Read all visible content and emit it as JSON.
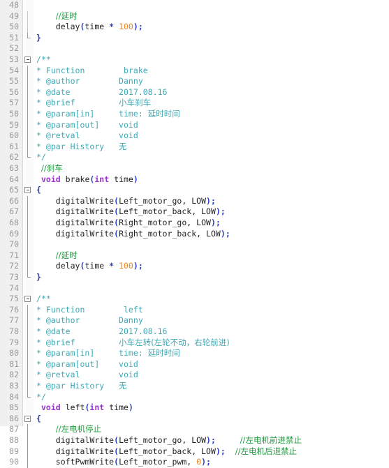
{
  "editor": {
    "kind": "code-editor-pane",
    "language": "c-arduino",
    "first_line": 48,
    "last_line": 90,
    "colors": {
      "background": "#ffffff",
      "gutter_background": "#f0f0f0",
      "gutter_border": "#d9d9d9",
      "line_number": "#9a9a9a",
      "plain_text": "#1f1f1f",
      "line_comment": "#1f9b3f",
      "doc_comment": "#3ea8b4",
      "keyword": "#9b30d0",
      "number": "#e8872a",
      "punctuation": "#2a3fc4",
      "fold_marker": "#8a8a8a"
    },
    "lines": [
      {
        "n": 48,
        "fold": "none",
        "tokens": []
      },
      {
        "n": 49,
        "fold": "bar",
        "tokens": [
          {
            "t": "    ",
            "c": "plain"
          },
          {
            "t": "//延时",
            "c": "comment"
          }
        ]
      },
      {
        "n": 50,
        "fold": "bar",
        "tokens": [
          {
            "t": "    ",
            "c": "plain"
          },
          {
            "t": "delay",
            "c": "func"
          },
          {
            "t": "(",
            "c": "punct"
          },
          {
            "t": "time ",
            "c": "plain"
          },
          {
            "t": "*",
            "c": "punct"
          },
          {
            "t": " ",
            "c": "plain"
          },
          {
            "t": "100",
            "c": "number"
          },
          {
            "t": ");",
            "c": "punct"
          }
        ]
      },
      {
        "n": 51,
        "fold": "end",
        "tokens": [
          {
            "t": "}",
            "c": "punct"
          }
        ]
      },
      {
        "n": 52,
        "fold": "none",
        "tokens": []
      },
      {
        "n": 53,
        "fold": "box",
        "tokens": [
          {
            "t": "/**",
            "c": "doc"
          }
        ]
      },
      {
        "n": 54,
        "fold": "line",
        "tokens": [
          {
            "t": "* Function        brake",
            "c": "doc"
          }
        ]
      },
      {
        "n": 55,
        "fold": "line",
        "tokens": [
          {
            "t": "* @author        Danny",
            "c": "doc"
          }
        ]
      },
      {
        "n": 56,
        "fold": "line",
        "tokens": [
          {
            "t": "* @date          2017.08.16",
            "c": "doc"
          }
        ]
      },
      {
        "n": 57,
        "fold": "line",
        "tokens": [
          {
            "t": "* @brief         ",
            "c": "doc"
          },
          {
            "t": "小车刹车",
            "c": "doc-cn"
          }
        ]
      },
      {
        "n": 58,
        "fold": "line",
        "tokens": [
          {
            "t": "* @param[in]     time: ",
            "c": "doc"
          },
          {
            "t": "延时时间",
            "c": "doc-cn"
          }
        ]
      },
      {
        "n": 59,
        "fold": "line",
        "tokens": [
          {
            "t": "* @param[out]    void",
            "c": "doc"
          }
        ]
      },
      {
        "n": 60,
        "fold": "line",
        "tokens": [
          {
            "t": "* @retval        void",
            "c": "doc"
          }
        ]
      },
      {
        "n": 61,
        "fold": "line",
        "tokens": [
          {
            "t": "* @par History   ",
            "c": "doc"
          },
          {
            "t": "无",
            "c": "doc-cn"
          }
        ]
      },
      {
        "n": 62,
        "fold": "end",
        "tokens": [
          {
            "t": "*/",
            "c": "doc"
          }
        ]
      },
      {
        "n": 63,
        "fold": "none",
        "tokens": [
          {
            "t": " ",
            "c": "plain"
          },
          {
            "t": "//刹车",
            "c": "comment"
          }
        ]
      },
      {
        "n": 64,
        "fold": "none",
        "tokens": [
          {
            "t": " ",
            "c": "plain"
          },
          {
            "t": "void",
            "c": "keyword"
          },
          {
            "t": " brake",
            "c": "func"
          },
          {
            "t": "(",
            "c": "punct"
          },
          {
            "t": "int",
            "c": "keyword"
          },
          {
            "t": " time",
            "c": "plain"
          },
          {
            "t": ")",
            "c": "punct"
          }
        ]
      },
      {
        "n": 65,
        "fold": "box",
        "tokens": [
          {
            "t": "{",
            "c": "punct"
          }
        ]
      },
      {
        "n": 66,
        "fold": "line",
        "tokens": [
          {
            "t": "    ",
            "c": "plain"
          },
          {
            "t": "digitalWrite",
            "c": "func"
          },
          {
            "t": "(",
            "c": "punct"
          },
          {
            "t": "Left_motor_go, LOW",
            "c": "plain"
          },
          {
            "t": ");",
            "c": "punct"
          }
        ]
      },
      {
        "n": 67,
        "fold": "line",
        "tokens": [
          {
            "t": "    ",
            "c": "plain"
          },
          {
            "t": "digitalWrite",
            "c": "func"
          },
          {
            "t": "(",
            "c": "punct"
          },
          {
            "t": "Left_motor_back, LOW",
            "c": "plain"
          },
          {
            "t": ");",
            "c": "punct"
          }
        ]
      },
      {
        "n": 68,
        "fold": "line",
        "tokens": [
          {
            "t": "    ",
            "c": "plain"
          },
          {
            "t": "digitalWrite",
            "c": "func"
          },
          {
            "t": "(",
            "c": "punct"
          },
          {
            "t": "Right_motor_go, LOW",
            "c": "plain"
          },
          {
            "t": ");",
            "c": "punct"
          }
        ]
      },
      {
        "n": 69,
        "fold": "line",
        "tokens": [
          {
            "t": "    ",
            "c": "plain"
          },
          {
            "t": "digitalWrite",
            "c": "func"
          },
          {
            "t": "(",
            "c": "punct"
          },
          {
            "t": "Right_motor_back, LOW",
            "c": "plain"
          },
          {
            "t": ");",
            "c": "punct"
          }
        ]
      },
      {
        "n": 70,
        "fold": "line",
        "tokens": []
      },
      {
        "n": 71,
        "fold": "line",
        "tokens": [
          {
            "t": "    ",
            "c": "plain"
          },
          {
            "t": "//延时",
            "c": "comment"
          }
        ]
      },
      {
        "n": 72,
        "fold": "line",
        "tokens": [
          {
            "t": "    ",
            "c": "plain"
          },
          {
            "t": "delay",
            "c": "func"
          },
          {
            "t": "(",
            "c": "punct"
          },
          {
            "t": "time ",
            "c": "plain"
          },
          {
            "t": "*",
            "c": "punct"
          },
          {
            "t": " ",
            "c": "plain"
          },
          {
            "t": "100",
            "c": "number"
          },
          {
            "t": ");",
            "c": "punct"
          }
        ]
      },
      {
        "n": 73,
        "fold": "end",
        "tokens": [
          {
            "t": "}",
            "c": "punct"
          }
        ]
      },
      {
        "n": 74,
        "fold": "none",
        "tokens": []
      },
      {
        "n": 75,
        "fold": "box",
        "tokens": [
          {
            "t": "/**",
            "c": "doc"
          }
        ]
      },
      {
        "n": 76,
        "fold": "line",
        "tokens": [
          {
            "t": "* Function        left",
            "c": "doc"
          }
        ]
      },
      {
        "n": 77,
        "fold": "line",
        "tokens": [
          {
            "t": "* @author        Danny",
            "c": "doc"
          }
        ]
      },
      {
        "n": 78,
        "fold": "line",
        "tokens": [
          {
            "t": "* @date          2017.08.16",
            "c": "doc"
          }
        ]
      },
      {
        "n": 79,
        "fold": "line",
        "tokens": [
          {
            "t": "* @brief         ",
            "c": "doc"
          },
          {
            "t": "小车左转(左轮不动，右轮前进)",
            "c": "doc-cn"
          }
        ]
      },
      {
        "n": 80,
        "fold": "line",
        "tokens": [
          {
            "t": "* @param[in]     time: ",
            "c": "doc"
          },
          {
            "t": "延时时间",
            "c": "doc-cn"
          }
        ]
      },
      {
        "n": 81,
        "fold": "line",
        "tokens": [
          {
            "t": "* @param[out]    void",
            "c": "doc"
          }
        ]
      },
      {
        "n": 82,
        "fold": "line",
        "tokens": [
          {
            "t": "* @retval        void",
            "c": "doc"
          }
        ]
      },
      {
        "n": 83,
        "fold": "line",
        "tokens": [
          {
            "t": "* @par History   ",
            "c": "doc"
          },
          {
            "t": "无",
            "c": "doc-cn"
          }
        ]
      },
      {
        "n": 84,
        "fold": "end",
        "tokens": [
          {
            "t": "*/",
            "c": "doc"
          }
        ]
      },
      {
        "n": 85,
        "fold": "none",
        "tokens": [
          {
            "t": " ",
            "c": "plain"
          },
          {
            "t": "void",
            "c": "keyword"
          },
          {
            "t": " left",
            "c": "func"
          },
          {
            "t": "(",
            "c": "punct"
          },
          {
            "t": "int",
            "c": "keyword"
          },
          {
            "t": " time",
            "c": "plain"
          },
          {
            "t": ")",
            "c": "punct"
          }
        ]
      },
      {
        "n": 86,
        "fold": "box",
        "tokens": [
          {
            "t": "{",
            "c": "punct"
          }
        ]
      },
      {
        "n": 87,
        "fold": "line",
        "tokens": [
          {
            "t": "    ",
            "c": "plain"
          },
          {
            "t": "//左电机停止",
            "c": "comment"
          }
        ]
      },
      {
        "n": 88,
        "fold": "line",
        "tokens": [
          {
            "t": "    ",
            "c": "plain"
          },
          {
            "t": "digitalWrite",
            "c": "func"
          },
          {
            "t": "(",
            "c": "punct"
          },
          {
            "t": "Left_motor_go, LOW",
            "c": "plain"
          },
          {
            "t": ");",
            "c": "punct"
          },
          {
            "t": "     ",
            "c": "plain"
          },
          {
            "t": "//左电机前进禁止",
            "c": "comment"
          }
        ]
      },
      {
        "n": 89,
        "fold": "line",
        "tokens": [
          {
            "t": "    ",
            "c": "plain"
          },
          {
            "t": "digitalWrite",
            "c": "func"
          },
          {
            "t": "(",
            "c": "punct"
          },
          {
            "t": "Left_motor_back, LOW",
            "c": "plain"
          },
          {
            "t": ");",
            "c": "punct"
          },
          {
            "t": "  ",
            "c": "plain"
          },
          {
            "t": "//左电机后退禁止",
            "c": "comment"
          }
        ]
      },
      {
        "n": 90,
        "fold": "line",
        "tokens": [
          {
            "t": "    ",
            "c": "plain"
          },
          {
            "t": "softPwmWrite",
            "c": "func"
          },
          {
            "t": "(",
            "c": "punct"
          },
          {
            "t": "Left_motor_pwm, ",
            "c": "plain"
          },
          {
            "t": "0",
            "c": "number"
          },
          {
            "t": ");",
            "c": "punct"
          }
        ]
      }
    ]
  }
}
